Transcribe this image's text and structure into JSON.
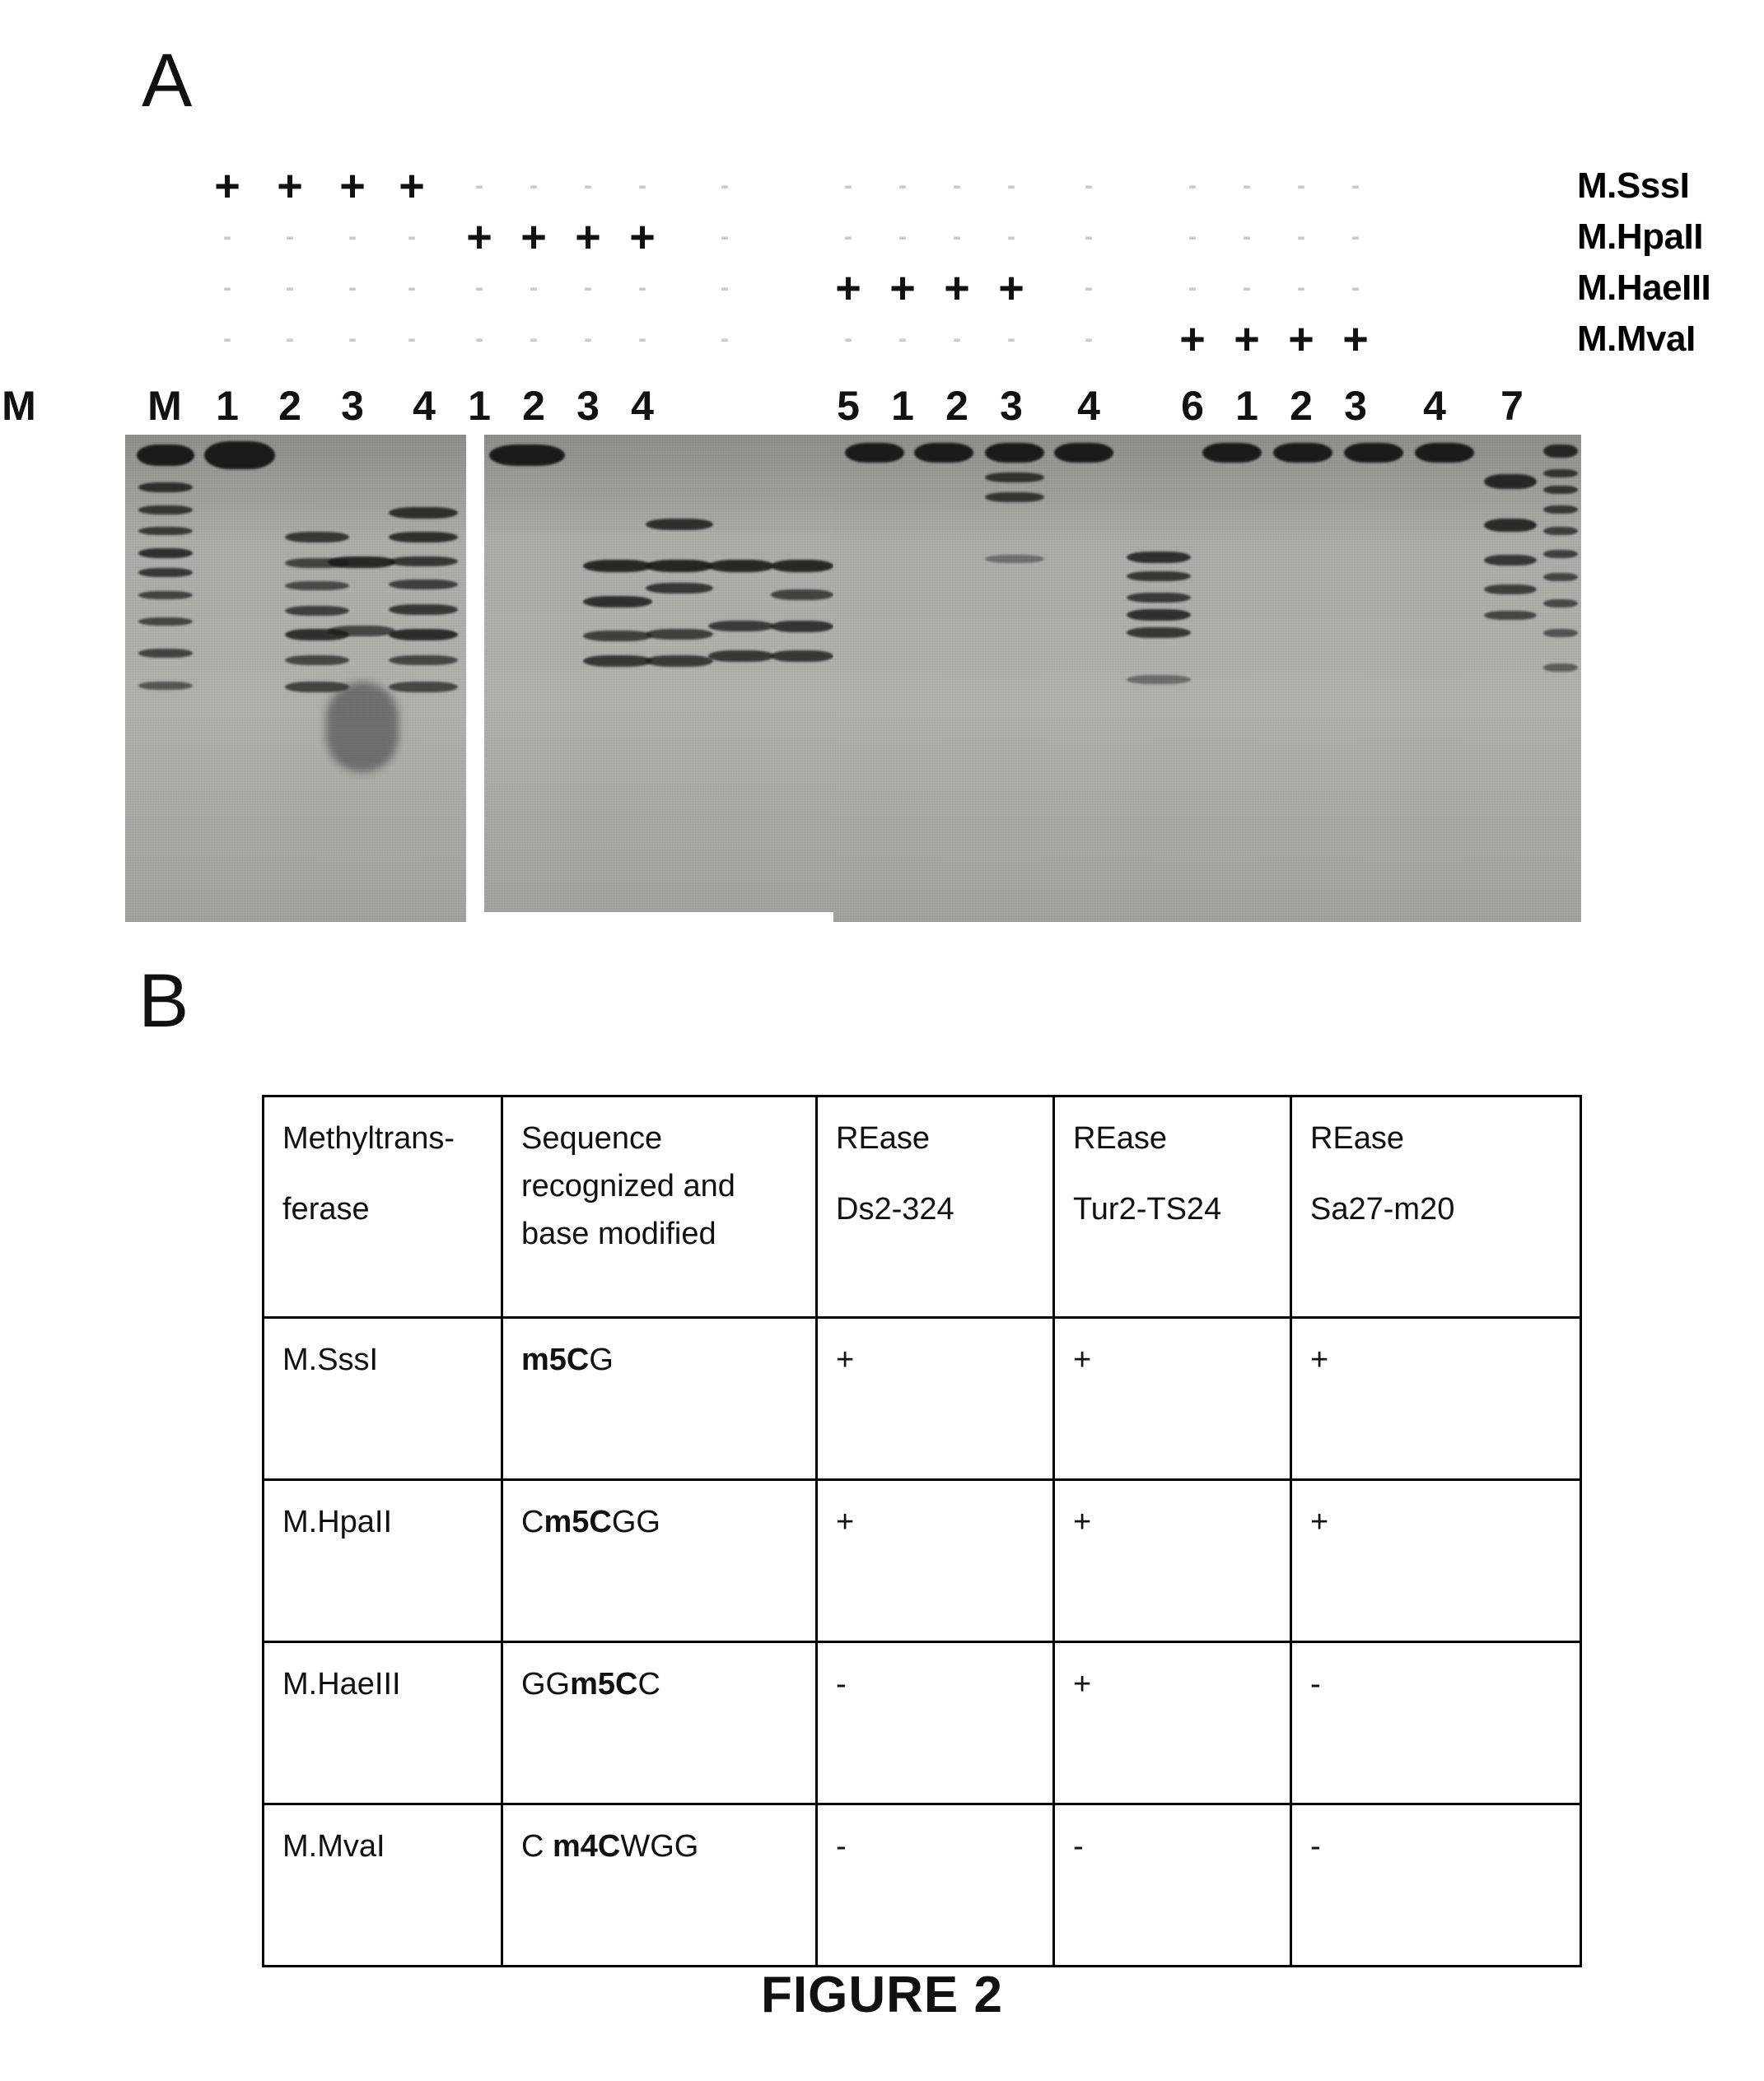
{
  "figure": {
    "caption": "FIGURE 2",
    "panel_a_letter": "A",
    "panel_b_letter": "B"
  },
  "panel_a": {
    "description": "Agarose gel electrophoresis of plasmid DNA methylated by four methyltransferases and digested with restriction endonucleases",
    "mark_plus": "+",
    "mark_minus": "-",
    "row_labels": [
      "M.SssI",
      "M.HpaII",
      "M.HaeIII",
      "M.MvaI"
    ],
    "matrix_rows": [
      {
        "label": "M.SssI",
        "marks": [
          "+",
          "+",
          "+",
          "+",
          "-",
          "-",
          "-",
          "-",
          "-",
          "-",
          "-",
          "-",
          "-",
          "-",
          "-",
          "-",
          "-",
          "-",
          "-"
        ]
      },
      {
        "label": "M.HpaII",
        "marks": [
          "-",
          "-",
          "-",
          "-",
          "+",
          "+",
          "+",
          "+",
          "-",
          "-",
          "-",
          "-",
          "-",
          "-",
          "-",
          "-",
          "-",
          "-",
          "-"
        ]
      },
      {
        "label": "M.HaeIII",
        "marks": [
          "-",
          "-",
          "-",
          "-",
          "-",
          "-",
          "-",
          "-",
          "-",
          "+",
          "+",
          "+",
          "+",
          "-",
          "-",
          "-",
          "-",
          "-",
          "-"
        ]
      },
      {
        "label": "M.MvaI",
        "marks": [
          "-",
          "-",
          "-",
          "-",
          "-",
          "-",
          "-",
          "-",
          "-",
          "-",
          "-",
          "-",
          "-",
          "-",
          "+",
          "+",
          "+",
          "+",
          "-"
        ]
      }
    ],
    "lane_labels": [
      "M",
      "1",
      "2",
      "3",
      "4",
      "1",
      "2",
      "3",
      "4",
      "5",
      "1",
      "2",
      "3",
      "4",
      "6",
      "1",
      "2",
      "3",
      "4",
      "7",
      "M"
    ],
    "gel_panels": [
      {
        "name": "gel-panel-left",
        "lanes": [
          "M",
          "1",
          "2",
          "3",
          "4"
        ]
      },
      {
        "name": "gel-panel-middle",
        "lanes": [
          "1",
          "2",
          "3",
          "4",
          "5"
        ]
      },
      {
        "name": "gel-panel-right",
        "lanes": [
          "1",
          "2",
          "3",
          "4",
          "6",
          "1",
          "2",
          "3",
          "4",
          "7",
          "M"
        ]
      }
    ]
  },
  "panel_b": {
    "table": {
      "headers": [
        {
          "line1": "Methyltrans-",
          "line2": "ferase"
        },
        {
          "line1": "Sequence",
          "line2": "recognized and",
          "line3": "base modified"
        },
        {
          "line1": "REase",
          "line2": "Ds2-324"
        },
        {
          "line1": "REase",
          "line2": "Tur2-TS24"
        },
        {
          "line1": "REase",
          "line2": "Sa27-m20"
        }
      ],
      "rows": [
        {
          "methyltransferase": "M.SssI",
          "sequence_parts": [
            {
              "t": "m5C",
              "b": true
            },
            {
              "t": "G",
              "b": false
            }
          ],
          "ds2_324": "+",
          "tur2_ts24": "+",
          "sa27_m20": "+"
        },
        {
          "methyltransferase": "M.HpaII",
          "sequence_parts": [
            {
              "t": "C",
              "b": false
            },
            {
              "t": "m5C",
              "b": true
            },
            {
              "t": "GG",
              "b": false
            }
          ],
          "ds2_324": "+",
          "tur2_ts24": "+",
          "sa27_m20": "+"
        },
        {
          "methyltransferase": "M.HaeIII",
          "sequence_parts": [
            {
              "t": "GG",
              "b": false
            },
            {
              "t": "m5C",
              "b": true
            },
            {
              "t": "C",
              "b": false
            }
          ],
          "ds2_324": "-",
          "tur2_ts24": "+",
          "sa27_m20": "-"
        },
        {
          "methyltransferase": "M.MvaI",
          "sequence_parts": [
            {
              "t": "C ",
              "b": false
            },
            {
              "t": "m4C",
              "b": true
            },
            {
              "t": "WGG",
              "b": false
            }
          ],
          "ds2_324": "-",
          "tur2_ts24": "-",
          "sa27_m20": "-"
        }
      ]
    }
  },
  "colors": {
    "ink": "#111111",
    "gel_background": "#b9b9b4",
    "band": "#1b1b1b",
    "faint_mark": "#c9c9c9"
  }
}
